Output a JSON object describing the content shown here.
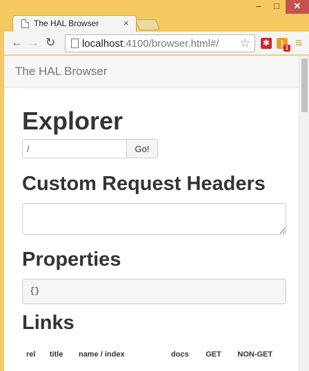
{
  "browser": {
    "tab_title": "The HAL Browser",
    "tab_close": "×",
    "url_host": "localhost",
    "url_rest": ":4100/browser.html#/",
    "window_controls": {
      "minimize": "–",
      "maximize": "□",
      "close": "✕"
    },
    "icons": [
      "page-icon",
      "back-icon",
      "forward-icon",
      "reload-icon",
      "star-icon",
      "extension-icon",
      "rss-icon",
      "menu-icon"
    ]
  },
  "app": {
    "brand": "The HAL Browser",
    "explorer": {
      "heading": "Explorer",
      "input_value": "/",
      "go_label": "Go!"
    },
    "custom_headers": {
      "heading": "Custom Request Headers",
      "value": ""
    },
    "properties": {
      "heading": "Properties",
      "value": "{}"
    },
    "links": {
      "heading": "Links",
      "columns": [
        "rel",
        "title",
        "name / index",
        "docs",
        "GET",
        "NON-GET"
      ]
    }
  }
}
